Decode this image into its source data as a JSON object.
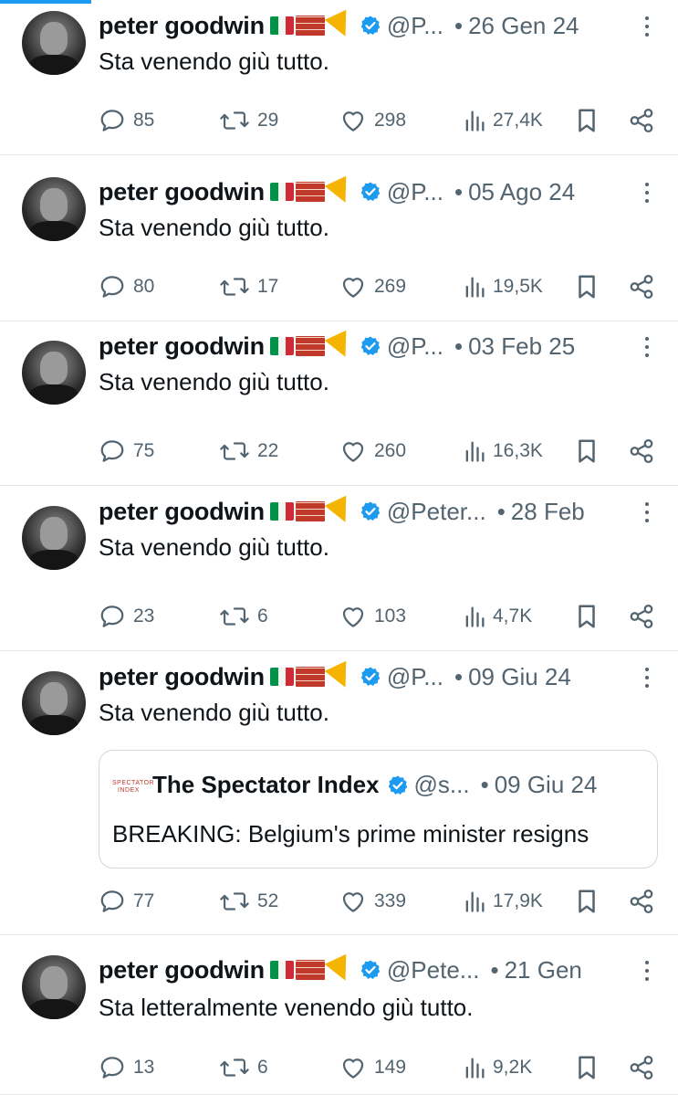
{
  "accent_color": "#1d9bf0",
  "secondary_text_color": "#536471",
  "tweets": [
    {
      "name": "peter goodwin",
      "emoji": [
        "italy-flag",
        "brick",
        "pizza"
      ],
      "handle": "@P...",
      "date": "26 Gen 24",
      "text": "Sta venendo giù tutto.",
      "replies": "85",
      "reposts": "29",
      "likes": "298",
      "views": "27,4K"
    },
    {
      "name": "peter goodwin",
      "emoji": [
        "italy-flag",
        "brick",
        "pizza"
      ],
      "handle": "@P...",
      "date": "05 Ago 24",
      "text": "Sta venendo giù tutto.",
      "replies": "80",
      "reposts": "17",
      "likes": "269",
      "views": "19,5K"
    },
    {
      "name": "peter goodwin",
      "emoji": [
        "italy-flag",
        "brick",
        "pizza"
      ],
      "handle": "@P...",
      "date": "03 Feb 25",
      "text": "Sta venendo giù tutto.",
      "replies": "75",
      "reposts": "22",
      "likes": "260",
      "views": "16,3K"
    },
    {
      "name": "peter goodwin",
      "emoji": [
        "italy-flag",
        "brick",
        "pizza"
      ],
      "handle": "@Peter...",
      "date": "28 Feb",
      "text": "Sta venendo giù tutto.",
      "replies": "23",
      "reposts": "6",
      "likes": "103",
      "views": "4,7K"
    },
    {
      "name": "peter goodwin",
      "emoji": [
        "italy-flag",
        "brick",
        "pizza"
      ],
      "handle": "@P...",
      "date": "09 Giu 24",
      "text": "Sta venendo giù tutto.",
      "quote": {
        "logo_text": "SPECTATOR INDEX",
        "name": "The Spectator Index",
        "handle": "@s...",
        "date": "09 Giu 24",
        "text": "BREAKING: Belgium's prime minister resigns"
      },
      "replies": "77",
      "reposts": "52",
      "likes": "339",
      "views": "17,9K"
    },
    {
      "name": "peter goodwin",
      "emoji": [
        "italy-flag",
        "brick",
        "pizza"
      ],
      "handle": "@Pete...",
      "date": "21 Gen",
      "text": "Sta letteralmente venendo giù tutto.",
      "replies": "13",
      "reposts": "6",
      "likes": "149",
      "views": "9,2K"
    }
  ]
}
